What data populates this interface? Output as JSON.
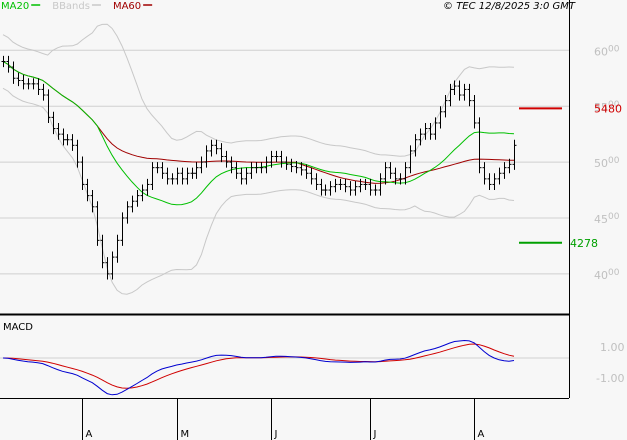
{
  "legend": [
    {
      "label": "MA20",
      "color": "#00c000"
    },
    {
      "label": "BBands",
      "color": "#c8c8c8"
    },
    {
      "label": "MA60",
      "color": "#a00000"
    }
  ],
  "copyright": "© TEC 12/8/2025 3:0 GMT",
  "chart_data": {
    "type": "line",
    "title": "",
    "price_axis": {
      "ylim": [
        36.5,
        64.5
      ],
      "ticks": [
        {
          "v": 60,
          "main": "60",
          "sup": "00"
        },
        {
          "v": 55,
          "main": "55",
          "sup": "00"
        },
        {
          "v": 50,
          "main": "50",
          "sup": "00"
        },
        {
          "v": 45,
          "main": "45",
          "sup": "00"
        },
        {
          "v": 40,
          "main": "40",
          "sup": "00"
        }
      ]
    },
    "x_ticks": [
      {
        "label": "A",
        "index": 16
      },
      {
        "label": "M",
        "index": 35
      },
      {
        "label": "J",
        "index": 54
      },
      {
        "label": "J",
        "index": 74
      },
      {
        "label": "A",
        "index": 95
      }
    ],
    "closes": [
      59,
      58.5,
      57.5,
      57.3,
      57,
      57,
      57,
      56.5,
      56,
      54,
      53,
      52.5,
      52,
      52,
      51.5,
      50,
      48,
      47,
      46,
      43,
      41,
      40,
      41.5,
      43,
      45,
      46,
      46.5,
      47,
      47.5,
      48,
      49.5,
      49.5,
      49,
      48.5,
      48.5,
      49,
      48.5,
      49,
      49,
      49.5,
      50,
      51,
      51.5,
      51.2,
      50.5,
      50,
      49.5,
      49,
      48.5,
      49,
      49.5,
      49.5,
      49.5,
      50,
      50.5,
      50.5,
      50,
      49.8,
      49.6,
      49.5,
      49.3,
      49,
      48.5,
      48,
      47.5,
      47.5,
      47.8,
      48,
      48,
      47.8,
      47.5,
      47.8,
      48,
      48,
      47.5,
      47.5,
      48.5,
      49.5,
      49,
      48.5,
      48.5,
      49.5,
      51,
      52,
      52.5,
      53,
      52.5,
      53.5,
      54.5,
      55.5,
      56.5,
      56.8,
      56,
      56.5,
      55.5,
      53.5,
      49.5,
      48.5,
      48,
      48.5,
      49,
      49.5,
      49.8,
      51.5
    ],
    "levels": [
      {
        "label": "5480",
        "value": 54.8,
        "color": "#d00000"
      },
      {
        "label": "4278",
        "value": 42.78,
        "color": "#00a000"
      }
    ],
    "macd": {
      "title": "MACD",
      "ticks": [
        {
          "v": 1,
          "label": "1.00"
        },
        {
          "v": -1,
          "label": "-1.00"
        }
      ],
      "ylim": [
        -2.5,
        2.5
      ],
      "series": [
        {
          "name": "MACD",
          "color": "#0000d0"
        },
        {
          "name": "Signal",
          "color": "#d00000"
        }
      ]
    }
  }
}
